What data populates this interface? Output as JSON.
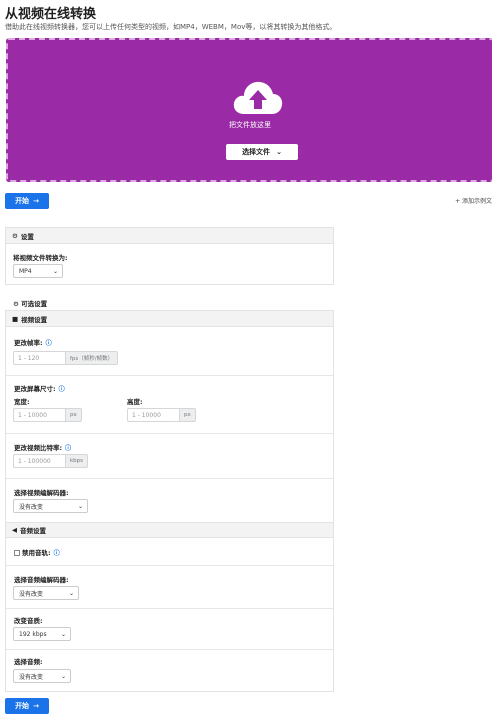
{
  "page": {
    "title": "从视频在线转换",
    "subtitle": "借助此在线视频转换器，您可以上传任何类型的视频，如MP4，WEBM，Mov等，以将其转换为其他格式。"
  },
  "upload": {
    "drop_text": "把文件放这里",
    "choose_label": "选择文件",
    "bg_color": "#9b2aa6"
  },
  "start_button": {
    "label": "开始",
    "arrow": "→"
  },
  "add_example": "+ 添加示例文",
  "settings": {
    "header": "设置",
    "convert_to_label": "将视频文件转换为:",
    "convert_to_value": "MP4"
  },
  "optional": {
    "header": "可选设置",
    "video": {
      "header": "视频设置",
      "frame_rate_label": "更改帧率:",
      "frame_rate_placeholder": "1 - 120",
      "frame_rate_unit": "fps（帧秒/帧数）",
      "resize_label": "更改屏幕尺寸:",
      "width_label": "宽度:",
      "width_placeholder": "1 - 10000",
      "width_unit": "px",
      "height_label": "高度:",
      "height_placeholder": "1 - 10000",
      "height_unit": "px",
      "bitrate_label": "更改视频比特率:",
      "bitrate_placeholder": "1 - 100000",
      "bitrate_unit": "kbps",
      "codec_label": "选择视频编解码器:",
      "codec_value": "没有改变"
    },
    "audio": {
      "header": "音频设置",
      "disable_label": "禁用音轨:",
      "codec_label": "选择音频编解码器:",
      "codec_value": "没有改变",
      "bitrate_label": "改变音质:",
      "bitrate_value": "192 kbps",
      "channel_label": "选择音频:",
      "channel_value": "没有改变"
    }
  },
  "icons": {
    "info": "ⓘ",
    "caret": "⌄",
    "gear": "⚙",
    "video": "■",
    "audio": "◀"
  },
  "colors": {
    "accent": "#1a73e8",
    "purple": "#9b2aa6"
  }
}
